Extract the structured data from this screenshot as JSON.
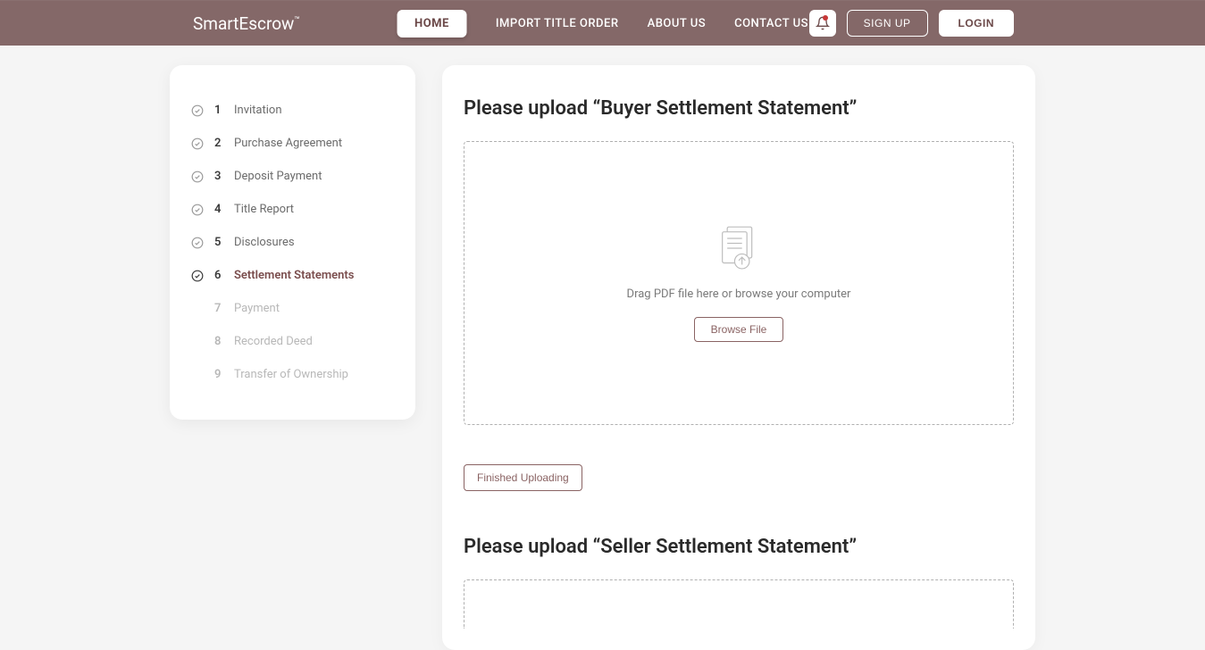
{
  "brand": {
    "name": "SmartEscrow",
    "tm": "™"
  },
  "nav": {
    "home": "HOME",
    "import": "IMPORT TITLE ORDER",
    "about": "ABOUT US",
    "contact": "CONTACT US"
  },
  "auth": {
    "signup": "SIGN UP",
    "login": "LOGIN"
  },
  "steps": [
    {
      "num": "1",
      "label": "Invitation",
      "state": "done"
    },
    {
      "num": "2",
      "label": "Purchase Agreement",
      "state": "done"
    },
    {
      "num": "3",
      "label": "Deposit Payment",
      "state": "done"
    },
    {
      "num": "4",
      "label": "Title Report",
      "state": "done"
    },
    {
      "num": "5",
      "label": "Disclosures",
      "state": "done"
    },
    {
      "num": "6",
      "label": "Settlement Statements",
      "state": "active"
    },
    {
      "num": "7",
      "label": "Payment",
      "state": "future"
    },
    {
      "num": "8",
      "label": "Recorded Deed",
      "state": "future"
    },
    {
      "num": "9",
      "label": "Transfer of Ownership",
      "state": "future"
    }
  ],
  "upload1": {
    "title": "Please upload “Buyer Settlement Statement”",
    "dropText": "Drag PDF file here or browse your computer",
    "browse": "Browse File",
    "finished": "Finished Uploading"
  },
  "upload2": {
    "title": "Please upload “Seller Settlement Statement”"
  }
}
